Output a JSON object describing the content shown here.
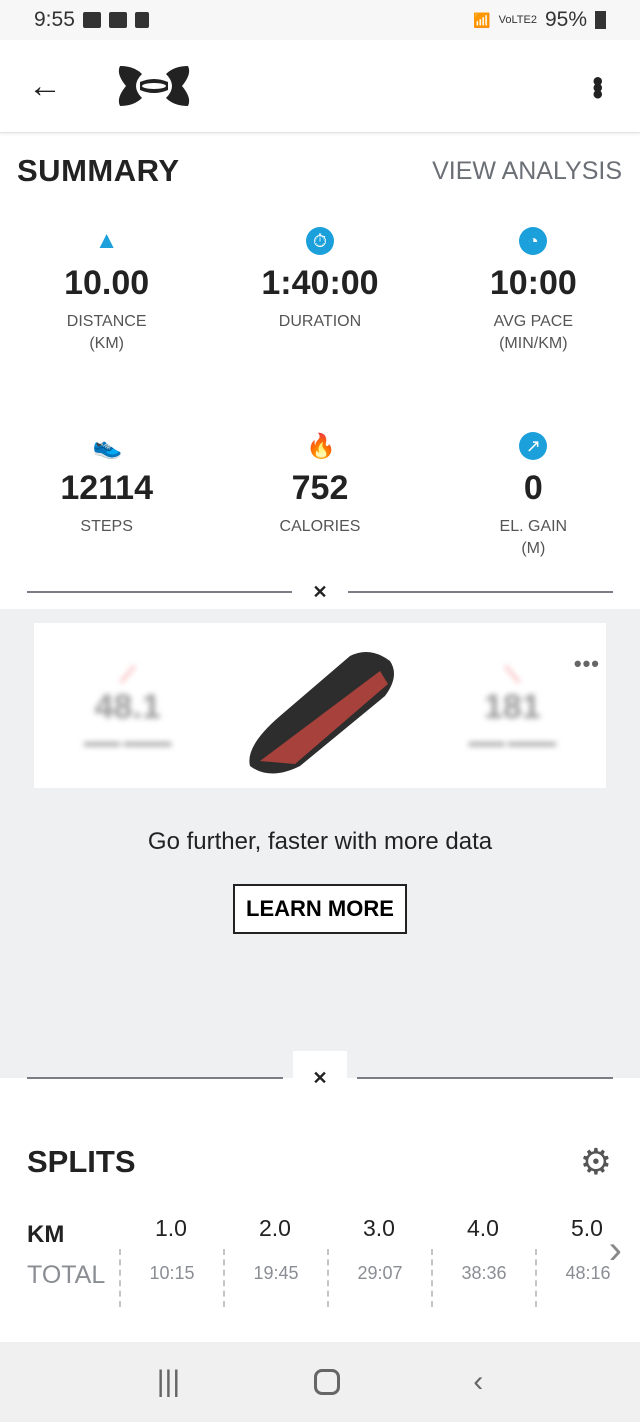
{
  "status": {
    "time": "9:55",
    "network": "VoLTE2",
    "battery": "95%"
  },
  "appbar": {
    "back_icon": "arrow-left-icon",
    "logo": "Under Armour",
    "menu_icon": "more-vert-icon"
  },
  "summary": {
    "title": "SUMMARY",
    "view_analysis": "VIEW ANALYSIS",
    "accent": "#1ba0dc",
    "stats": [
      {
        "icon": "road-icon",
        "value": "10.00",
        "label": "DISTANCE\n(KM)"
      },
      {
        "icon": "stopwatch-icon",
        "value": "1:40:00",
        "label": "DURATION"
      },
      {
        "icon": "speedometer-icon",
        "value": "10:00",
        "label": "AVG PACE\n(MIN/KM)"
      },
      {
        "icon": "shoe-icon",
        "value": "12114",
        "label": "STEPS"
      },
      {
        "icon": "flame-icon",
        "value": "752",
        "label": "CALORIES"
      },
      {
        "icon": "arrow-up-right-icon",
        "value": "0",
        "label": "EL. GAIN\n(M)"
      }
    ]
  },
  "promo": {
    "blurred_left": "48.1",
    "blurred_right": "181",
    "text": "Go further, faster with more data",
    "button": "LEARN MORE"
  },
  "splits": {
    "title": "SPLITS",
    "km_label": "KM",
    "total_label": "TOTAL",
    "km": [
      "1.0",
      "2.0",
      "3.0",
      "4.0",
      "5.0"
    ],
    "total": [
      "10:15",
      "19:45",
      "29:07",
      "38:36",
      "48:16"
    ]
  }
}
